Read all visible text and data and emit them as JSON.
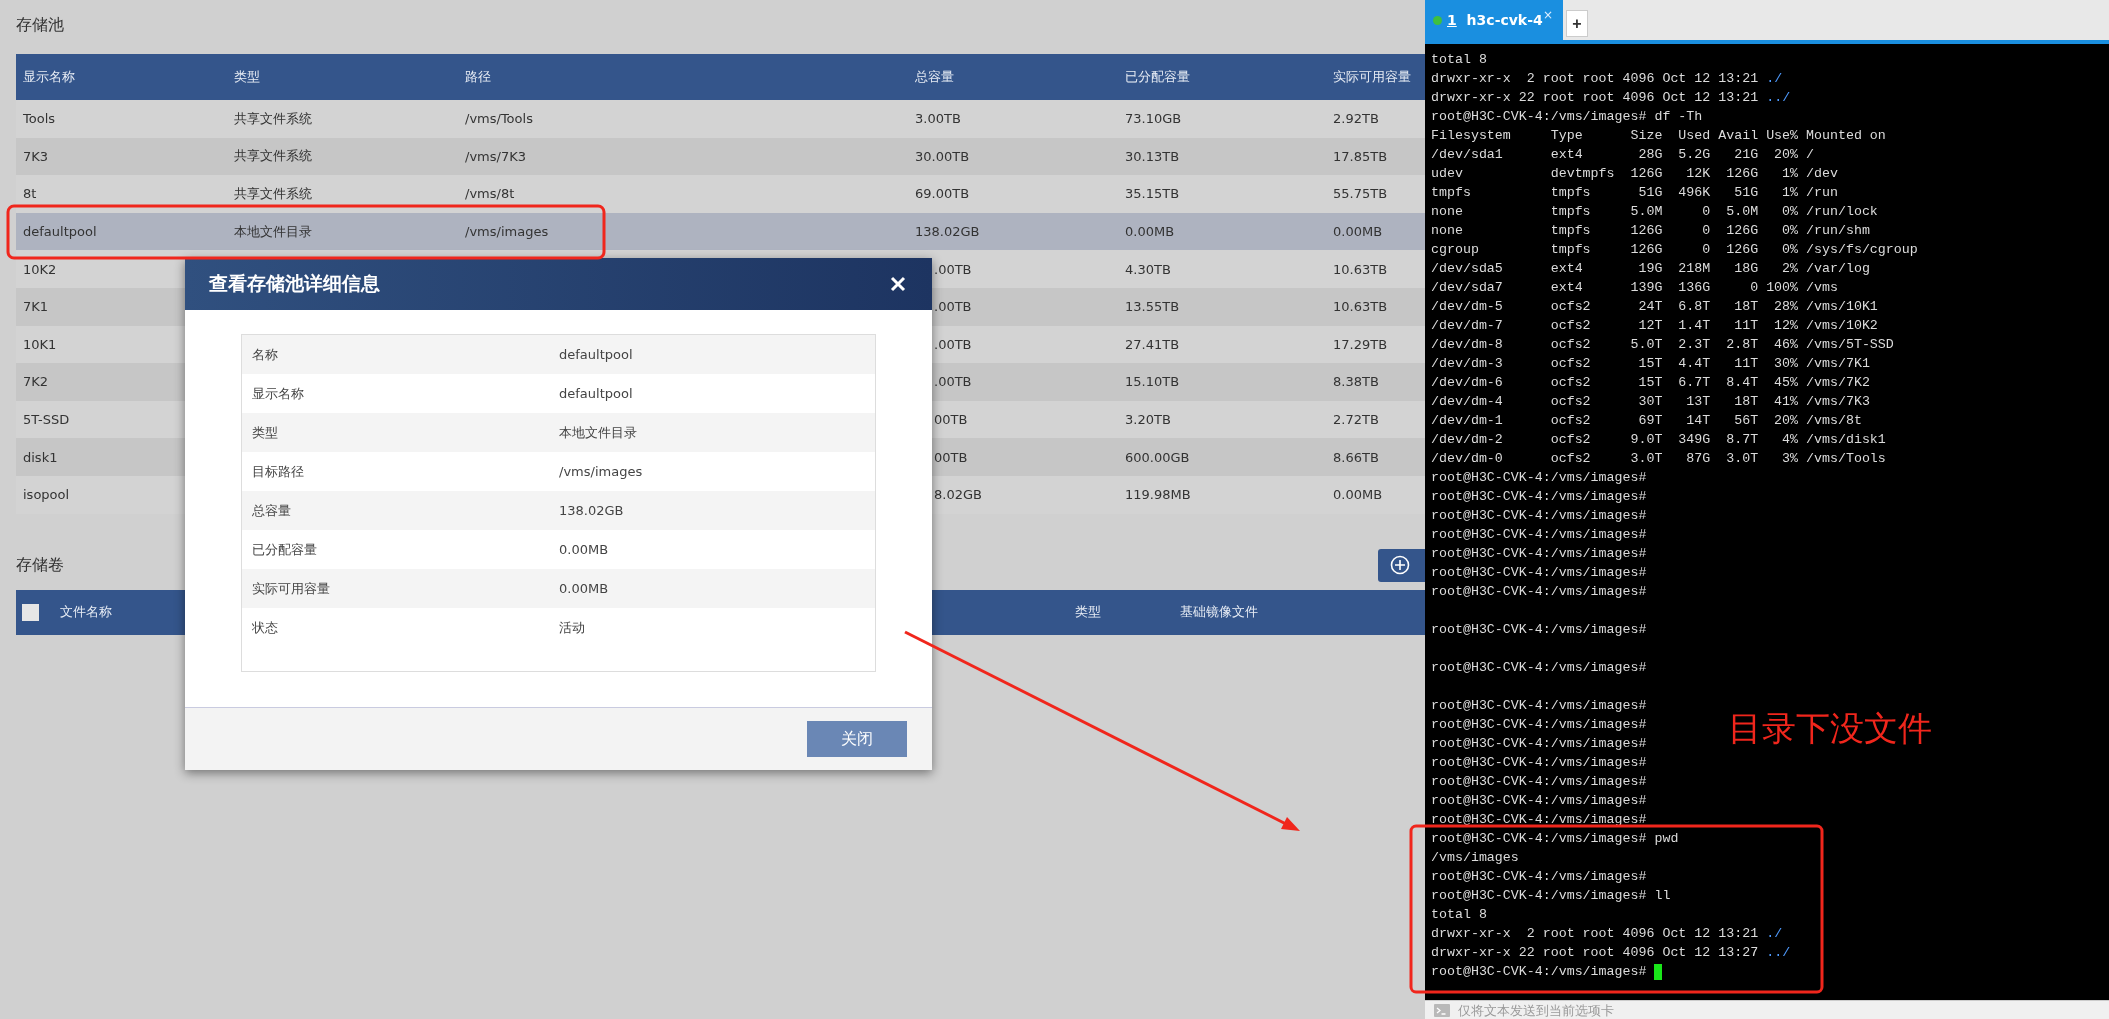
{
  "storage_pool": {
    "title": "存储池",
    "columns": [
      "显示名称",
      "类型",
      "路径",
      "总容量",
      "已分配容量",
      "实际可用容量"
    ],
    "rows": [
      {
        "name": "Tools",
        "type": "共享文件系统",
        "path": "/vms/Tools",
        "total": "3.00TB",
        "allocated": "73.10GB",
        "available": "2.92TB",
        "selected": false
      },
      {
        "name": "7K3",
        "type": "共享文件系统",
        "path": "/vms/7K3",
        "total": "30.00TB",
        "allocated": "30.13TB",
        "available": "17.85TB",
        "selected": false
      },
      {
        "name": "8t",
        "type": "共享文件系统",
        "path": "/vms/8t",
        "total": "69.00TB",
        "allocated": "35.15TB",
        "available": "55.75TB",
        "selected": false
      },
      {
        "name": "defaultpool",
        "type": "本地文件目录",
        "path": "/vms/images",
        "total": "138.02GB",
        "allocated": "0.00MB",
        "available": "0.00MB",
        "selected": true
      },
      {
        "name": "10K2",
        "total": ".00TB",
        "allocated": "4.30TB",
        "available": "10.63TB",
        "selected": false
      },
      {
        "name": "7K1",
        "total": ".00TB",
        "allocated": "13.55TB",
        "available": "10.63TB",
        "selected": false
      },
      {
        "name": "10K1",
        "total": ".00TB",
        "allocated": "27.41TB",
        "available": "17.29TB",
        "selected": false
      },
      {
        "name": "7K2",
        "total": ".00TB",
        "allocated": "15.10TB",
        "available": "8.38TB",
        "selected": false
      },
      {
        "name": "5T-SSD",
        "total": "00TB",
        "allocated": "3.20TB",
        "available": "2.72TB",
        "selected": false
      },
      {
        "name": "disk1",
        "total": "00TB",
        "allocated": "600.00GB",
        "available": "8.66TB",
        "selected": false
      },
      {
        "name": "isopool",
        "total": "8.02GB",
        "allocated": "119.98MB",
        "available": "0.00MB",
        "selected": false
      }
    ]
  },
  "storage_volume": {
    "title": "存储卷",
    "select_all_checked": false,
    "columns": [
      {
        "label": "文件名称"
      },
      {
        "label": "类型"
      },
      {
        "label": "基础镜像文件"
      }
    ]
  },
  "dialog": {
    "title": "查看存储池详细信息",
    "fields": [
      {
        "label": "名称",
        "value": "defaultpool"
      },
      {
        "label": "显示名称",
        "value": "defaultpool"
      },
      {
        "label": "类型",
        "value": "本地文件目录"
      },
      {
        "label": "目标路径",
        "value": "/vms/images"
      },
      {
        "label": "总容量",
        "value": "138.02GB"
      },
      {
        "label": "已分配容量",
        "value": "0.00MB"
      },
      {
        "label": "实际可用容量",
        "value": "0.00MB"
      },
      {
        "label": "状态",
        "value": "活动"
      }
    ],
    "close_button": "关闭"
  },
  "terminal": {
    "tab": {
      "index": "1",
      "title": "h3c-cvk-4",
      "close": "×",
      "selected": true
    },
    "new_tab": "+",
    "blocks": [
      [
        {
          "text": "total 8"
        },
        {
          "text": "drwxr-xr-x  2 root root 4096 Oct 12 13:21",
          "dir": "./"
        },
        {
          "text": "drwxr-xr-x 22 root root 4096 Oct 12 13:21",
          "dir": "../"
        },
        {
          "text": "root@H3C-CVK-4:/vms/images# df -Th"
        },
        {
          "text": "Filesystem     Type      Size  Used Avail Use% Mounted on"
        },
        {
          "text": "/dev/sda1      ext4       28G  5.2G   21G  20% /"
        },
        {
          "text": "udev           devtmpfs  126G   12K  126G   1% /dev"
        },
        {
          "text": "tmpfs          tmpfs      51G  496K   51G   1% /run"
        },
        {
          "text": "none           tmpfs     5.0M     0  5.0M   0% /run/lock"
        },
        {
          "text": "none           tmpfs     126G     0  126G   0% /run/shm"
        },
        {
          "text": "cgroup         tmpfs     126G     0  126G   0% /sys/fs/cgroup"
        },
        {
          "text": "/dev/sda5      ext4       19G  218M   18G   2% /var/log"
        },
        {
          "text": "/dev/sda7      ext4      139G  136G     0 100% /vms"
        },
        {
          "text": "/dev/dm-5      ocfs2      24T  6.8T   18T  28% /vms/10K1"
        },
        {
          "text": "/dev/dm-7      ocfs2      12T  1.4T   11T  12% /vms/10K2"
        },
        {
          "text": "/dev/dm-8      ocfs2     5.0T  2.3T  2.8T  46% /vms/5T-SSD"
        },
        {
          "text": "/dev/dm-3      ocfs2      15T  4.4T   11T  30% /vms/7K1"
        },
        {
          "text": "/dev/dm-6      ocfs2      15T  6.7T  8.4T  45% /vms/7K2"
        },
        {
          "text": "/dev/dm-4      ocfs2      30T   13T   18T  41% /vms/7K3"
        },
        {
          "text": "/dev/dm-1      ocfs2      69T   14T   56T  20% /vms/8t"
        },
        {
          "text": "/dev/dm-2      ocfs2     9.0T  349G  8.7T   4% /vms/disk1"
        },
        {
          "text": "/dev/dm-0      ocfs2     3.0T   87G  3.0T   3% /vms/Tools"
        },
        {
          "text": "root@H3C-CVK-4:/vms/images#"
        },
        {
          "text": "root@H3C-CVK-4:/vms/images#"
        },
        {
          "text": "root@H3C-CVK-4:/vms/images#"
        },
        {
          "text": "root@H3C-CVK-4:/vms/images#"
        },
        {
          "text": "root@H3C-CVK-4:/vms/images#"
        },
        {
          "text": "root@H3C-CVK-4:/vms/images#"
        },
        {
          "text": "root@H3C-CVK-4:/vms/images#"
        }
      ],
      [
        {
          "text": "root@H3C-CVK-4:/vms/images#"
        }
      ],
      [
        {
          "text": "root@H3C-CVK-4:/vms/images#"
        }
      ],
      [
        {
          "text": "root@H3C-CVK-4:/vms/images#"
        },
        {
          "text": "root@H3C-CVK-4:/vms/images#"
        },
        {
          "text": "root@H3C-CVK-4:/vms/images#"
        },
        {
          "text": "root@H3C-CVK-4:/vms/images#"
        },
        {
          "text": "root@H3C-CVK-4:/vms/images#"
        },
        {
          "text": "root@H3C-CVK-4:/vms/images#"
        },
        {
          "text": "root@H3C-CVK-4:/vms/images#"
        },
        {
          "text": "root@H3C-CVK-4:/vms/images# pwd"
        },
        {
          "text": "/vms/images"
        },
        {
          "text": "root@H3C-CVK-4:/vms/images#"
        },
        {
          "text": "root@H3C-CVK-4:/vms/images# ll"
        },
        {
          "text": "total 8"
        },
        {
          "text": "drwxr-xr-x  2 root root 4096 Oct 12 13:21",
          "dir": "./"
        },
        {
          "text": "drwxr-xr-x 22 root root 4096 Oct 12 13:27",
          "dir": "../"
        },
        {
          "text": "root@H3C-CVK-4:/vms/images#"
        }
      ]
    ],
    "cursor": true,
    "input_placeholder": "仅将文本发送到当前选项卡"
  },
  "annotation": {
    "note": "目录下没文件"
  }
}
